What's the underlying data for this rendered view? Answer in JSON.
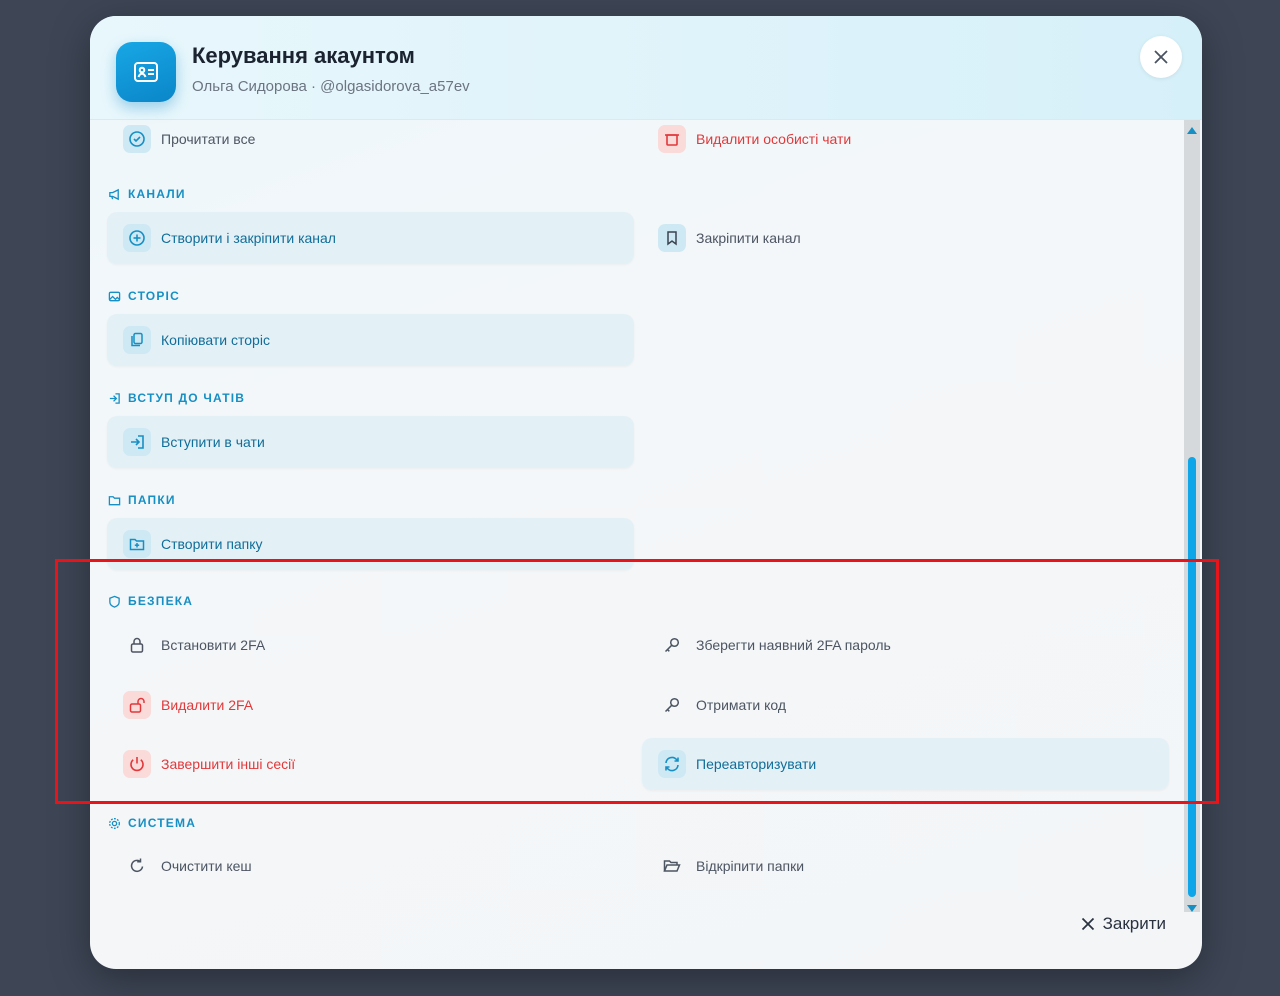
{
  "header": {
    "title": "Керування акаунтом",
    "subtitle": "Ольга Сидорова · @olgasidorova_a57ev"
  },
  "partial_row": {
    "left_label": "Прочитати все",
    "right_label": "Видалити особисті чати"
  },
  "sections": {
    "channels": {
      "title": "КАНАЛИ",
      "create_pin": "Створити і закріпити канал",
      "pin": "Закріпити канал"
    },
    "stories": {
      "title": "СТОРІС",
      "copy": "Копіювати сторіс"
    },
    "join": {
      "title": "ВСТУП ДО ЧАТІВ",
      "join_chats": "Вступити в чати"
    },
    "folders": {
      "title": "ПАПКИ",
      "create": "Створити папку"
    },
    "security": {
      "title": "БЕЗПЕКА",
      "set_2fa": "Встановити 2FA",
      "save_2fa": "Зберегти наявний 2FA пароль",
      "remove_2fa": "Видалити 2FA",
      "get_code": "Отримати код",
      "end_sessions": "Завершити інші сесії",
      "reauth": "Переавторизувати"
    },
    "system": {
      "title": "СИСТЕМА",
      "clear_cache": "Очистити кеш",
      "unpin_folders": "Відкріпити папки"
    }
  },
  "footer": {
    "close_label": "Закрити"
  },
  "colors": {
    "accent": "#168fc4",
    "danger": "#e2383a",
    "highlight_box": "#e8141a"
  }
}
